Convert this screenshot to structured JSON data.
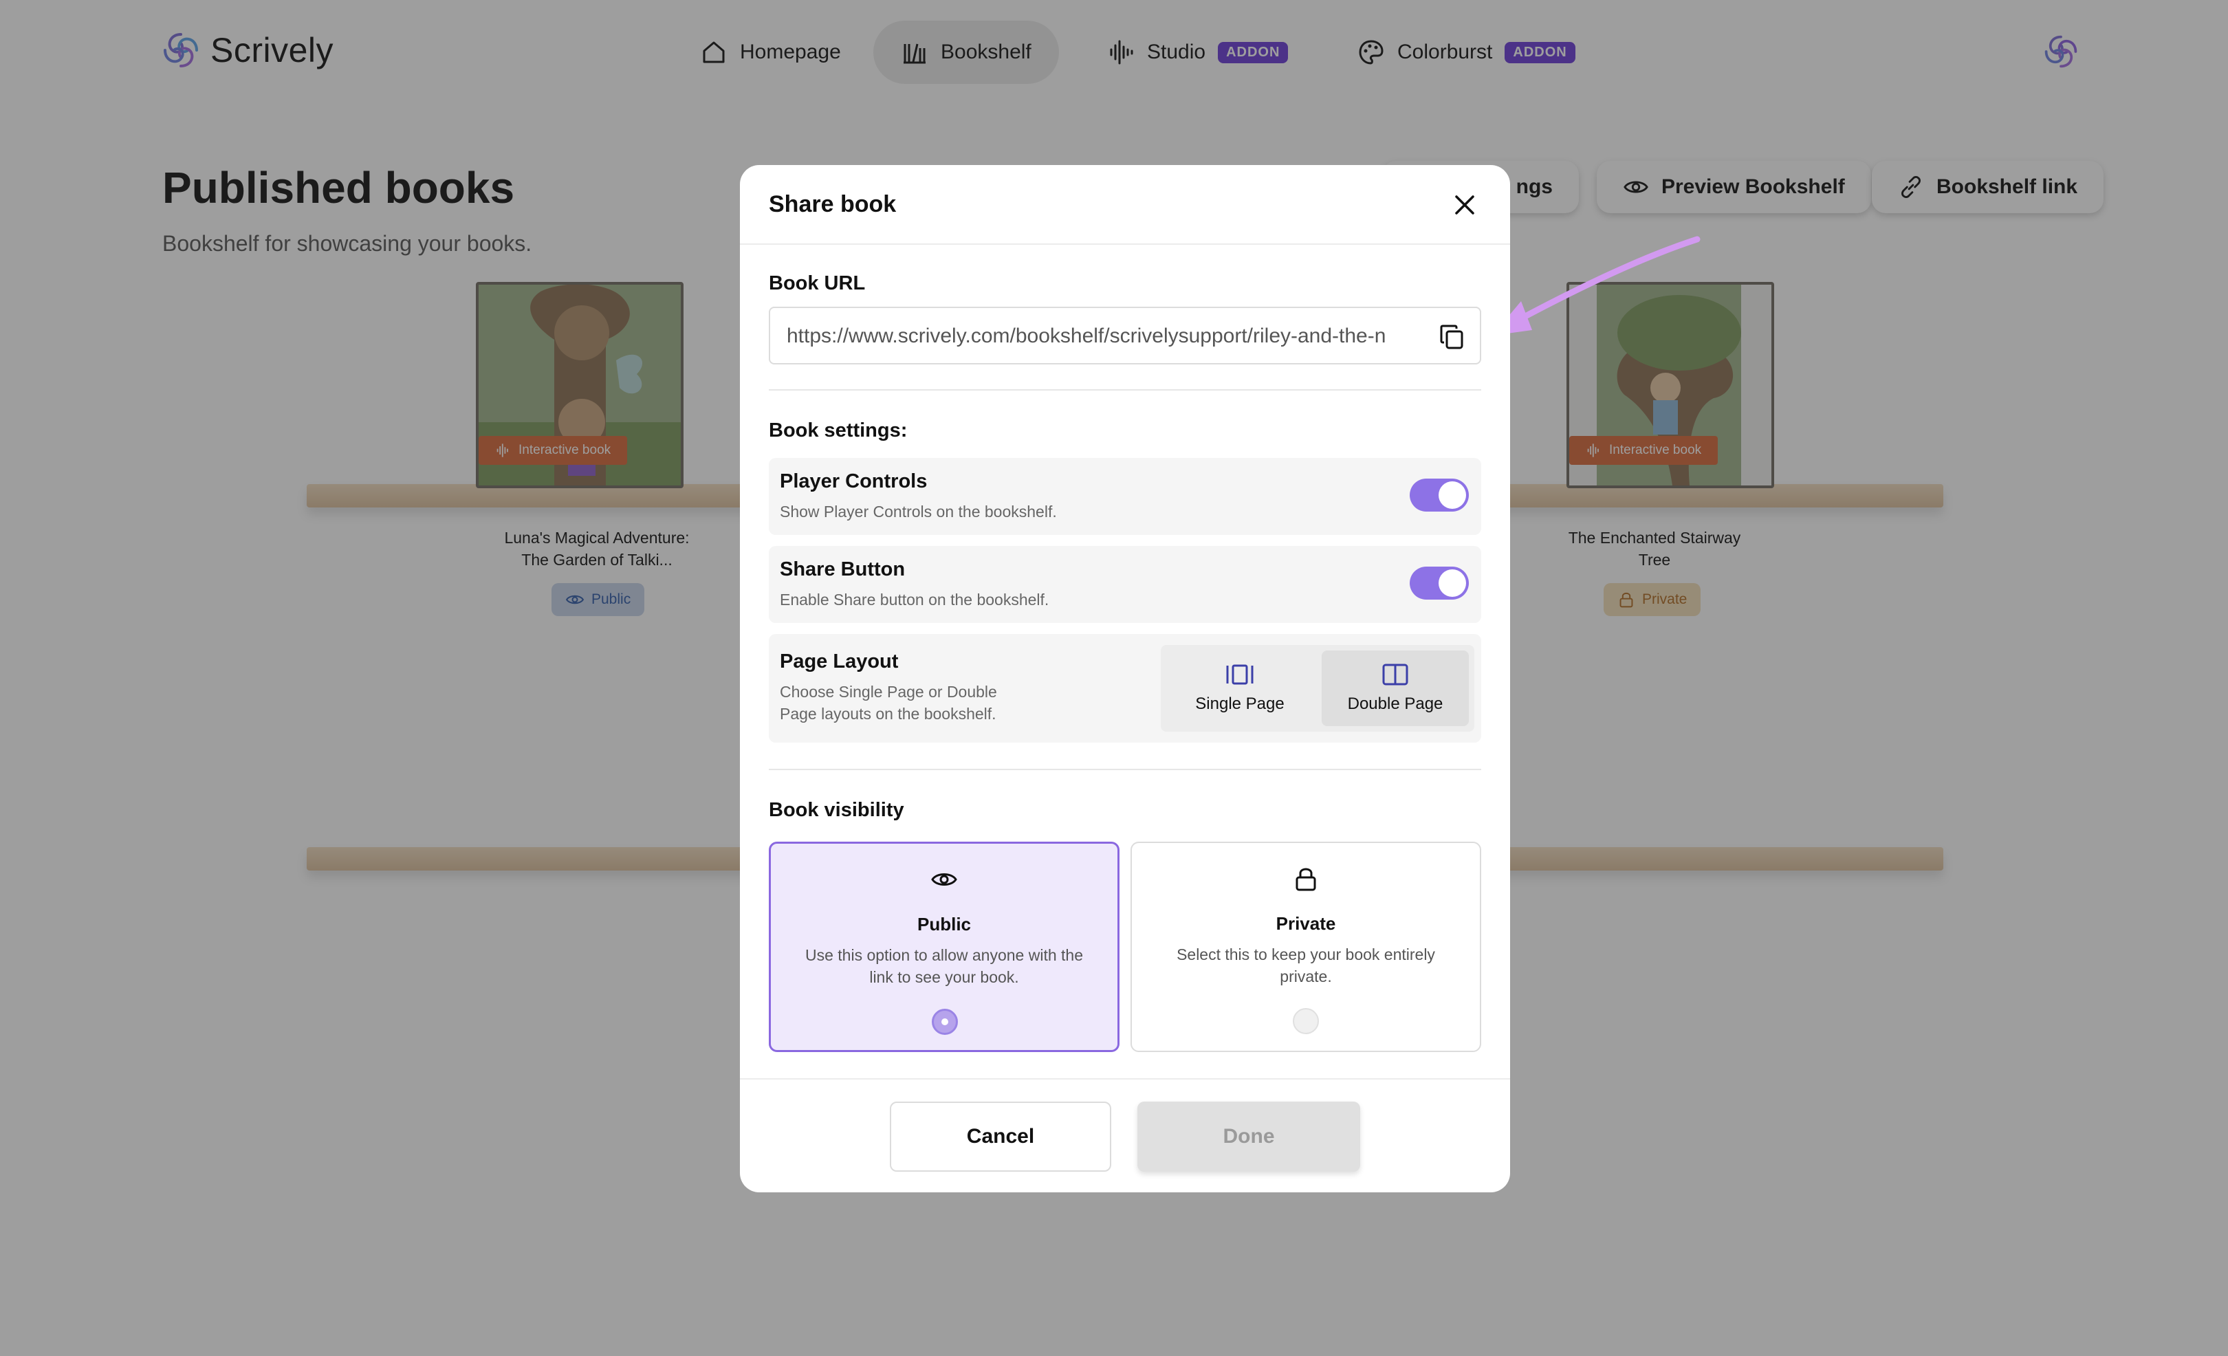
{
  "app": {
    "name": "Scrively",
    "logo_icon": "scrively-swirl-logo",
    "accent": "#8d72e6",
    "addon_color": "#6b3bd8"
  },
  "nav": {
    "items": [
      {
        "label": "Homepage",
        "icon": "home-icon"
      },
      {
        "label": "Bookshelf",
        "icon": "bookshelf-icon"
      },
      {
        "label": "Studio",
        "icon": "audio-wave-icon",
        "badge": "ADDON"
      },
      {
        "label": "Colorburst",
        "icon": "palette-icon",
        "badge": "ADDON"
      }
    ],
    "active": "Bookshelf"
  },
  "page": {
    "title": "Published books",
    "subtitle": "Bookshelf for showcasing your books.",
    "buttons": {
      "settings_partial": "ngs",
      "preview": "Preview Bookshelf",
      "link": "Bookshelf link"
    }
  },
  "books": [
    {
      "title_line1": "Luna's Magical Adventure:",
      "title_line2": "The Garden of Talki...",
      "tag": "Interactive book",
      "status": "Public"
    },
    {
      "title_line1": "The Enchanted Stairway",
      "title_line2": "Tree",
      "tag": "Interactive book",
      "status": "Private"
    }
  ],
  "modal": {
    "title": "Share book",
    "url_label": "Book URL",
    "url_value": "https://www.scrively.com/bookshelf/scrivelysupport/riley-and-the-n",
    "settings_label": "Book settings:",
    "player_controls": {
      "title": "Player Controls",
      "desc": "Show Player Controls on the bookshelf.",
      "enabled": true
    },
    "share_button": {
      "title": "Share Button",
      "desc": "Enable Share button on the bookshelf.",
      "enabled": true
    },
    "page_layout": {
      "title": "Page Layout",
      "desc_line1": "Choose Single Page or Double",
      "desc_line2": "Page layouts on the bookshelf.",
      "options": [
        "Single Page",
        "Double Page"
      ],
      "selected": "Double Page"
    },
    "visibility_label": "Book visibility",
    "visibility": {
      "public": {
        "title": "Public",
        "desc_line1": "Use this option to allow anyone with the",
        "desc_line2": "link to see your book."
      },
      "private": {
        "title": "Private",
        "desc_line1": "Select this to keep your book entirely",
        "desc_line2": "private."
      },
      "selected": "Public"
    },
    "cancel": "Cancel",
    "done": "Done"
  }
}
